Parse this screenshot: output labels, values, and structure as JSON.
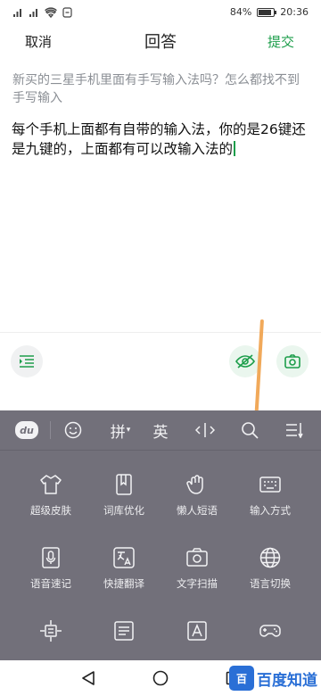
{
  "status": {
    "battery": "84%",
    "battery_level": 0.84,
    "time": "20:36"
  },
  "titlebar": {
    "cancel": "取消",
    "title": "回答",
    "submit": "提交"
  },
  "question": "新买的三星手机里面有手写输入法吗？怎么都找不到手写输入",
  "answer": "每个手机上面都有自带的输入法，你的是26键还是九键的，上面都有可以改输入法的",
  "keyboard": {
    "badge": "du",
    "tab_pinyin": "拼",
    "tab_pinyin_arrow": "▾",
    "tab_english": "英",
    "grid": [
      {
        "label": "超级皮肤",
        "icon": "shirt-icon"
      },
      {
        "label": "词库优化",
        "icon": "book-icon"
      },
      {
        "label": "懒人短语",
        "icon": "hand-icon"
      },
      {
        "label": "输入方式",
        "icon": "keyboard-icon"
      },
      {
        "label": "语音速记",
        "icon": "voice-note-icon"
      },
      {
        "label": "快捷翻译",
        "icon": "translate-icon"
      },
      {
        "label": "文字扫描",
        "icon": "camera-icon"
      },
      {
        "label": "语言切换",
        "icon": "globe-icon"
      },
      {
        "label": "",
        "icon": "cursor-move-icon"
      },
      {
        "label": "",
        "icon": "template-icon"
      },
      {
        "label": "",
        "icon": "font-icon"
      },
      {
        "label": "",
        "icon": "gamepad-icon"
      }
    ]
  },
  "watermark": {
    "logo": "百",
    "text": "百度知道"
  },
  "colors": {
    "accent": "#1d9e4b",
    "keyboard_bg": "#72707a",
    "annotation": "#f0a048"
  }
}
